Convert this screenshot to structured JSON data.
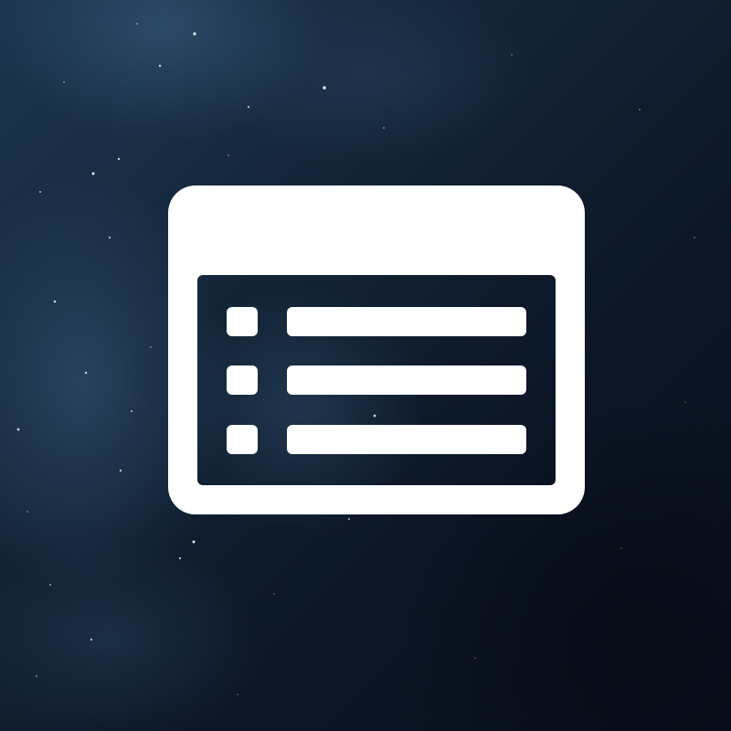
{
  "background": {
    "kind": "starfield",
    "base_color": "#0b1322",
    "nebula_color": "#2c4f72"
  },
  "icon": {
    "name": "list-window-icon",
    "color": "#ffffff",
    "rows": 3
  }
}
